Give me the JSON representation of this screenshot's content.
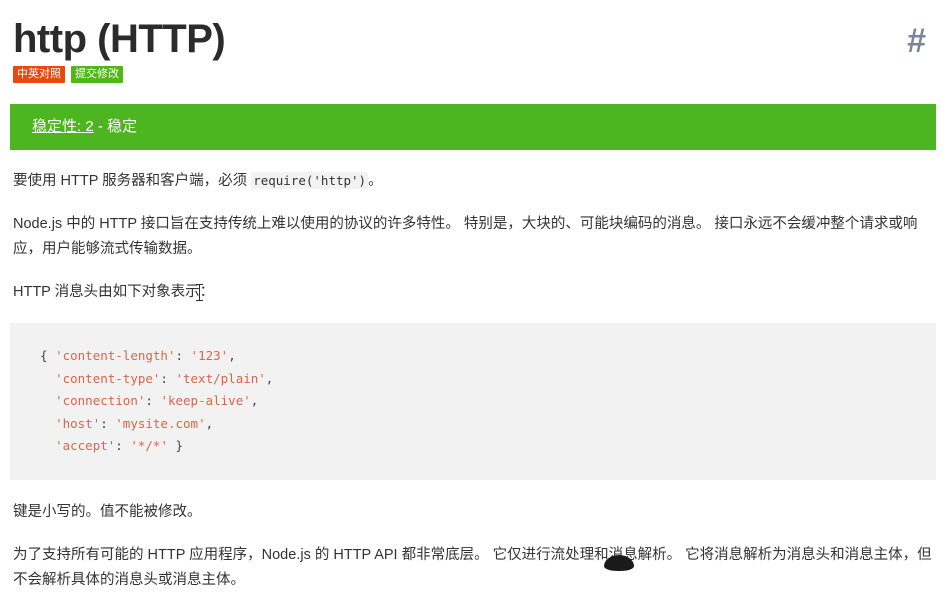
{
  "header": {
    "title": "http (HTTP)",
    "anchor": "#",
    "badges": [
      {
        "label": "中英对照",
        "color": "#e8490f",
        "name": "badge-bilingual"
      },
      {
        "label": "提交修改",
        "color": "#4fb816",
        "name": "badge-submit-edit"
      }
    ]
  },
  "stability": {
    "link_text": "稳定性: 2",
    "suffix": " - 稳定",
    "background": "#4cb520",
    "text_color": "#ffffff"
  },
  "content": {
    "para_1_pre": "要使用 HTTP 服务器和客户端，必须 ",
    "para_1_code": "require('http')",
    "para_1_post": "。",
    "para_2": "Node.js 中的 HTTP 接口旨在支持传统上难以使用的协议的许多特性。 特别是，大块的、可能块编码的消息。 接口永远不会缓冲整个请求或响应，用户能够流式传输数据。",
    "para_3": "HTTP 消息头由如下对象表示：",
    "para_4": "键是小写的。值不能被修改。",
    "para_5": "为了支持所有可能的 HTTP 应用程序，Node.js 的 HTTP API 都非常底层。 它仅进行流处理和消息解析。 它将消息解析为消息头和消息主体，但不会解析具体的消息头或消息主体。"
  },
  "code_block": {
    "background": "#f2f2f2",
    "string_color": "#d9654b",
    "lines": [
      {
        "indent": "",
        "open": "{ ",
        "key": "'content-length'",
        "sep": ": ",
        "value": "'123'",
        "tail": ","
      },
      {
        "indent": "  ",
        "open": "",
        "key": "'content-type'",
        "sep": ": ",
        "value": "'text/plain'",
        "tail": ","
      },
      {
        "indent": "  ",
        "open": "",
        "key": "'connection'",
        "sep": ": ",
        "value": "'keep-alive'",
        "tail": ","
      },
      {
        "indent": "  ",
        "open": "",
        "key": "'host'",
        "sep": ": ",
        "value": "'mysite.com'",
        "tail": ","
      },
      {
        "indent": "  ",
        "open": "",
        "key": "'accept'",
        "sep": ": ",
        "value": "'*/*'",
        "tail": " }"
      }
    ]
  }
}
